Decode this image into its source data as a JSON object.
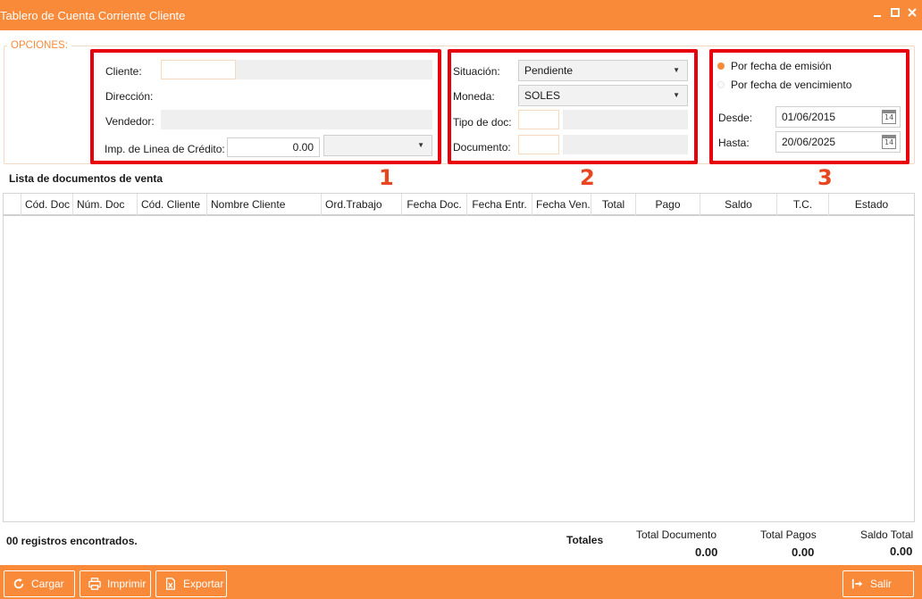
{
  "window": {
    "title": "Tablero de Cuenta Corriente Cliente",
    "controls": [
      "minimize-icon",
      "maximize-icon",
      "close-icon"
    ]
  },
  "options": {
    "legend": "OPCIONES:",
    "section1": {
      "number": "1",
      "cliente_label": "Cliente:",
      "cliente_code": "",
      "cliente_name": "",
      "direccion_label": "Dirección:",
      "direccion_value": "",
      "vendedor_label": "Vendedor:",
      "vendedor_value": "",
      "credito_label": "Imp. de Linea de Crédito:",
      "credito_value": "0.00",
      "credito_currency": ""
    },
    "section2": {
      "number": "2",
      "situacion_label": "Situación:",
      "situacion_value": "Pendiente",
      "moneda_label": "Moneda:",
      "moneda_value": "SOLES",
      "tipodoc_label": "Tipo de doc:",
      "tipodoc_code": "",
      "tipodoc_name": "",
      "documento_label": "Documento:",
      "documento_code": "",
      "documento_name": ""
    },
    "section3": {
      "number": "3",
      "radio_emision_label": "Por fecha de emisión",
      "radio_emision_selected": true,
      "radio_vencimiento_label": "Por fecha de vencimiento",
      "radio_vencimiento_selected": false,
      "desde_label": "Desde:",
      "desde_value": "01/06/2015",
      "hasta_label": "Hasta:",
      "hasta_value": "20/06/2025",
      "calendar_day": "14"
    }
  },
  "list": {
    "title": "Lista de documentos de venta",
    "columns": [
      "Cód. Doc",
      "Núm. Doc",
      "Cód. Cliente",
      "Nombre Cliente",
      "Ord.Trabajo",
      "Fecha Doc.",
      "Fecha Entr.",
      "Fecha Ven.",
      "Total",
      "Pago",
      "Saldo",
      "T.C.",
      "Estado"
    ],
    "rows": []
  },
  "footer": {
    "records": "00 registros encontrados.",
    "totales_label": "Totales",
    "total_documento_label": "Total Documento",
    "total_documento_value": "0.00",
    "total_pagos_label": "Total Pagos",
    "total_pagos_value": "0.00",
    "saldo_total_label": "Saldo Total",
    "saldo_total_value": "0.00"
  },
  "toolbar": {
    "cargar_label": "Cargar",
    "imprimir_label": "Imprimir",
    "exportar_label": "Exportar",
    "salir_label": "Salir"
  },
  "colors": {
    "accent": "#f98a3a",
    "highlight_box": "#e8000d",
    "highlight_number": "#e8461f"
  }
}
